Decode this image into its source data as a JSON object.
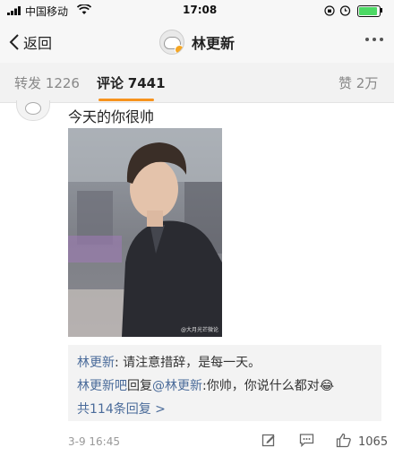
{
  "status_bar": {
    "carrier": "中国移动",
    "time": "17:08"
  },
  "nav": {
    "back_label": "返回",
    "title": "林更新"
  },
  "tabs": [
    {
      "label": "转发",
      "count": "1226"
    },
    {
      "label": "评论",
      "count": "7441"
    },
    {
      "label": "赞",
      "count": "2万"
    }
  ],
  "comment": {
    "text": "今天的你很帅",
    "image_watermark": "@大月光芒微论",
    "replies": [
      {
        "user": "林更新",
        "text": ": 请注意措辞，是每一天。"
      },
      {
        "user": "林更新吧",
        "middle": "回复",
        "target": "@林更新",
        "text": ":你帅，你说什么都对😂"
      }
    ],
    "more_replies": "共114条回复 >",
    "timestamp": "3-9 16:45",
    "likes": "1065"
  },
  "colors": {
    "accent_orange": "#f7931e",
    "link_blue": "#4a6b9a"
  }
}
